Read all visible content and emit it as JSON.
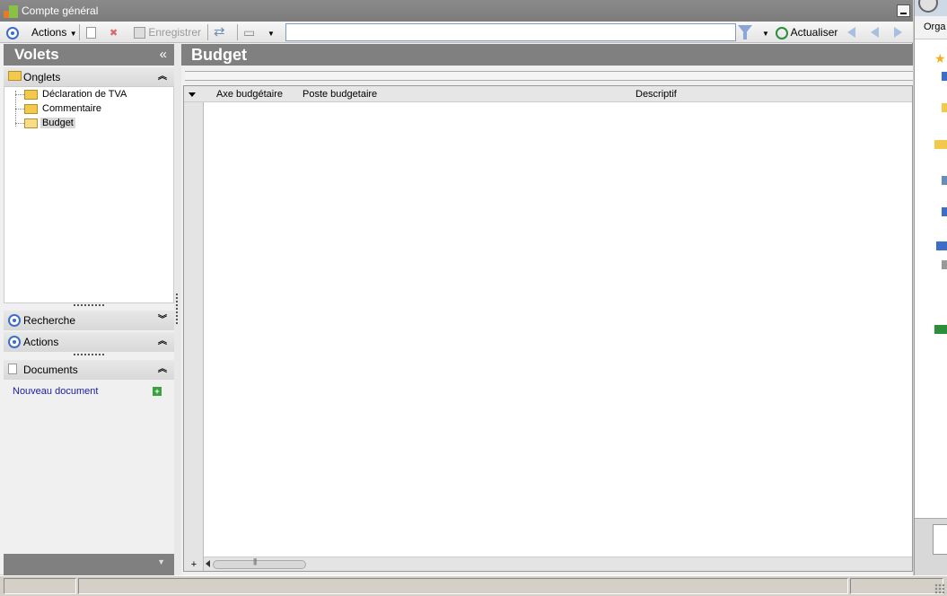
{
  "window": {
    "title": "Compte général"
  },
  "toolbar": {
    "actions_label": "Actions",
    "save_label": "Enregistrer",
    "search_value": "",
    "refresh_label": "Actualiser"
  },
  "left_panel": {
    "title": "Volets",
    "collapse_glyph": "«",
    "tabs_section": {
      "label": "Onglets",
      "items": [
        {
          "label": "Déclaration de TVA"
        },
        {
          "label": "Commentaire"
        },
        {
          "label": "Budget",
          "selected": true
        }
      ]
    },
    "search_section": {
      "label": "Recherche"
    },
    "actions_section": {
      "label": "Actions"
    },
    "documents_section": {
      "label": "Documents",
      "new_document_link": "Nouveau document"
    }
  },
  "main": {
    "title": "Budget",
    "grid": {
      "columns": [
        "Axe budgétaire",
        "Poste budgetaire",
        "Descriptif"
      ],
      "rows": []
    }
  },
  "background_window": {
    "partial_label": "Orga"
  },
  "colors": {
    "header_gray": "#808080",
    "link_blue": "#1a1aa8",
    "accent_blue": "#3c6ec8",
    "refresh_green": "#2a8e3a"
  }
}
